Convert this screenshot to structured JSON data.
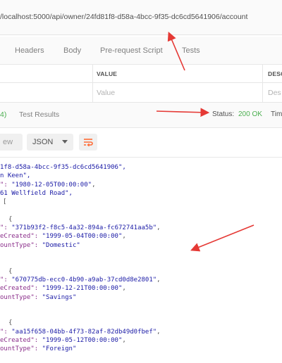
{
  "url": {
    "text": "/localhost:5000/api/owner/24fd81f8-d58a-4bcc-9f35-dc6cd5641906/account"
  },
  "request_tabs": [
    "Headers",
    "Body",
    "Pre-request Script",
    "Tests"
  ],
  "params_table": {
    "columns": [
      "VALUE",
      "DESC"
    ],
    "placeholders": [
      "Value",
      "Des"
    ]
  },
  "response_tabs": {
    "count_fragment": "4)",
    "test_results": "Test Results",
    "status_label": "Status:",
    "status_value": "200 OK",
    "time_label": "Tim"
  },
  "toolbar": {
    "preview_fragment": "ew",
    "format": "JSON",
    "dropdown_icon": "caret-down-icon",
    "wrap_icon": "wrap-lines-icon"
  },
  "colors": {
    "key": "#8b2f8b",
    "string": "#1a1aa6",
    "status_ok": "#4caf50",
    "arrow": "#e53935",
    "wrap_icon": "#ff6b35"
  },
  "response_body": {
    "lines": [
      [
        "",
        "1f8-d58a-4bcc-9f35-dc6cd5641906",
        "\","
      ],
      [
        "",
        "n Keen",
        "\","
      ],
      [
        "\": ",
        "\"1980-12-05T00:00:00\"",
        ","
      ],
      [
        "",
        "61 Wellfield Road",
        "\","
      ],
      [
        "[",
        "",
        ""
      ],
      [
        "",
        "",
        ""
      ],
      [
        "",
        "",
        "{"
      ],
      [
        "\": ",
        "\"371b93f2-f8c5-4a32-894a-fc672741aa5b\"",
        ","
      ],
      [
        "eCreated\": ",
        "\"1999-05-04T00:00:00\"",
        ","
      ],
      [
        "ountType\": ",
        "\"Domestic\"",
        ""
      ],
      [
        "",
        "",
        ""
      ],
      [
        "",
        "",
        ""
      ],
      [
        "",
        "",
        "{"
      ],
      [
        "\": ",
        "\"670775db-ecc0-4b90-a9ab-37cd0d8e2801\"",
        ","
      ],
      [
        "eCreated\": ",
        "\"1999-12-21T00:00:00\"",
        ","
      ],
      [
        "ountType\": ",
        "\"Savings\"",
        ""
      ],
      [
        "",
        "",
        ""
      ],
      [
        "",
        "",
        ""
      ],
      [
        "",
        "",
        "{"
      ],
      [
        "\": ",
        "\"aa15f658-04bb-4f73-82af-82db49d0fbef\"",
        ","
      ],
      [
        "eCreated\": ",
        "\"1999-05-12T00:00:00\"",
        ","
      ],
      [
        "ountType\": ",
        "\"Foreign\"",
        ""
      ]
    ]
  }
}
